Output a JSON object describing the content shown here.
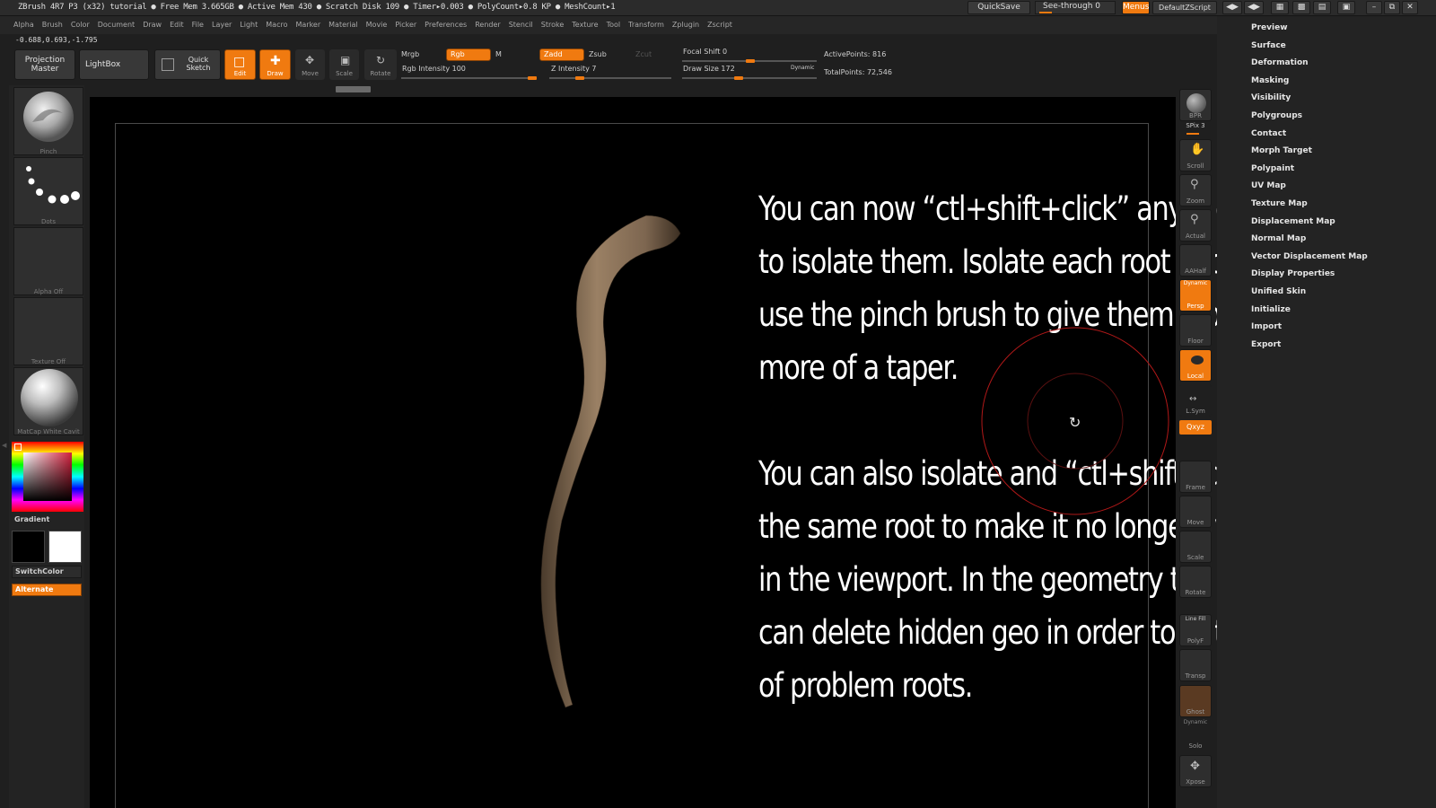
{
  "titlebar": {
    "title": "ZBrush 4R7 P3 (x32)   tutorial    ● Free Mem 3.665GB ● Active Mem 430 ● Scratch Disk 109 ●  Timer▸0.003 ● PolyCount▸0.8 KP ● MeshCount▸1",
    "quicksave": "QuickSave",
    "see_through": "See-through  0",
    "menus": "Menus",
    "default_zscript": "DefaultZScript"
  },
  "menubar": [
    "Alpha",
    "Brush",
    "Color",
    "Document",
    "Draw",
    "Edit",
    "File",
    "Layer",
    "Light",
    "Macro",
    "Marker",
    "Material",
    "Movie",
    "Picker",
    "Preferences",
    "Render",
    "Stencil",
    "Stroke",
    "Texture",
    "Tool",
    "Transform",
    "Zplugin",
    "Zscript"
  ],
  "coords": "-0.688,0.693,-1.795",
  "shelf": {
    "projection_master": "Projection Master",
    "lightbox": "LightBox",
    "quick_sketch": "Quick Sketch",
    "edit": "Edit",
    "draw": "Draw",
    "move": "Move",
    "scale": "Scale",
    "rotate": "Rotate",
    "mrgb": "Mrgb",
    "rgb": "Rgb",
    "m": "M",
    "zadd": "Zadd",
    "zsub": "Zsub",
    "zcut": "Zcut",
    "rgb_intensity": "Rgb Intensity 100",
    "z_intensity": "Z Intensity 7",
    "focal_shift": "Focal Shift 0",
    "draw_size": "Draw Size 172",
    "dynamic": "Dynamic",
    "active_points": "ActivePoints: 816",
    "total_points": "TotalPoints: 72,546"
  },
  "leftpanel": {
    "brush": "Pinch",
    "stroke": "Dots",
    "alpha": "Alpha  Off",
    "texture": "Texture  Off",
    "material": "MatCap  White  Cavit",
    "gradient": "Gradient",
    "switchcolor": "SwitchColor",
    "alternate": "Alternate"
  },
  "tutorial_text": {
    "para1": [
      "You can now “ctl+shift+click” any root",
      "to isolate them. Isolate each root and",
      "use the pinch brush to give them a bit",
      "more of a taper."
    ],
    "para2": [
      "You can also isolate and “ctl+shift+click”",
      "the same root to make it no longer visible",
      "in the viewport. In the geometry tab you",
      "can delete hidden geo in order to get rid",
      "of problem roots."
    ]
  },
  "right_toolbar": {
    "bpr": "BPR",
    "spix": "SPix 3",
    "scroll": "Scroll",
    "zoom": "Zoom",
    "actual": "Actual",
    "aahalf": "AAHalf",
    "dynamic": "Dynamic",
    "persp": "Persp",
    "floor": "Floor",
    "local": "Local",
    "lsym": "L.Sym",
    "xyz": "Qxyz",
    "frame": "Frame",
    "move": "Move",
    "scale": "Scale",
    "rotate": "Rotate",
    "line_fill": "Line Fill",
    "polyf": "PolyF",
    "transp": "Transp",
    "ghost": "Ghost",
    "dynamic2": "Dynamic",
    "solo": "Solo",
    "xpose": "Xpose"
  },
  "right_tray": [
    "Preview",
    "Surface",
    "Deformation",
    "Masking",
    "Visibility",
    "Polygroups",
    "Contact",
    "Morph Target",
    "Polypaint",
    "UV Map",
    "Texture Map",
    "Displacement Map",
    "Normal Map",
    "Vector Displacement Map",
    "Display Properties",
    "Unified Skin",
    "Initialize",
    "Import",
    "Export"
  ],
  "colors": {
    "accent": "#f07a10",
    "viewport": "#000000",
    "panel": "#232323",
    "root": "#8a7358"
  }
}
